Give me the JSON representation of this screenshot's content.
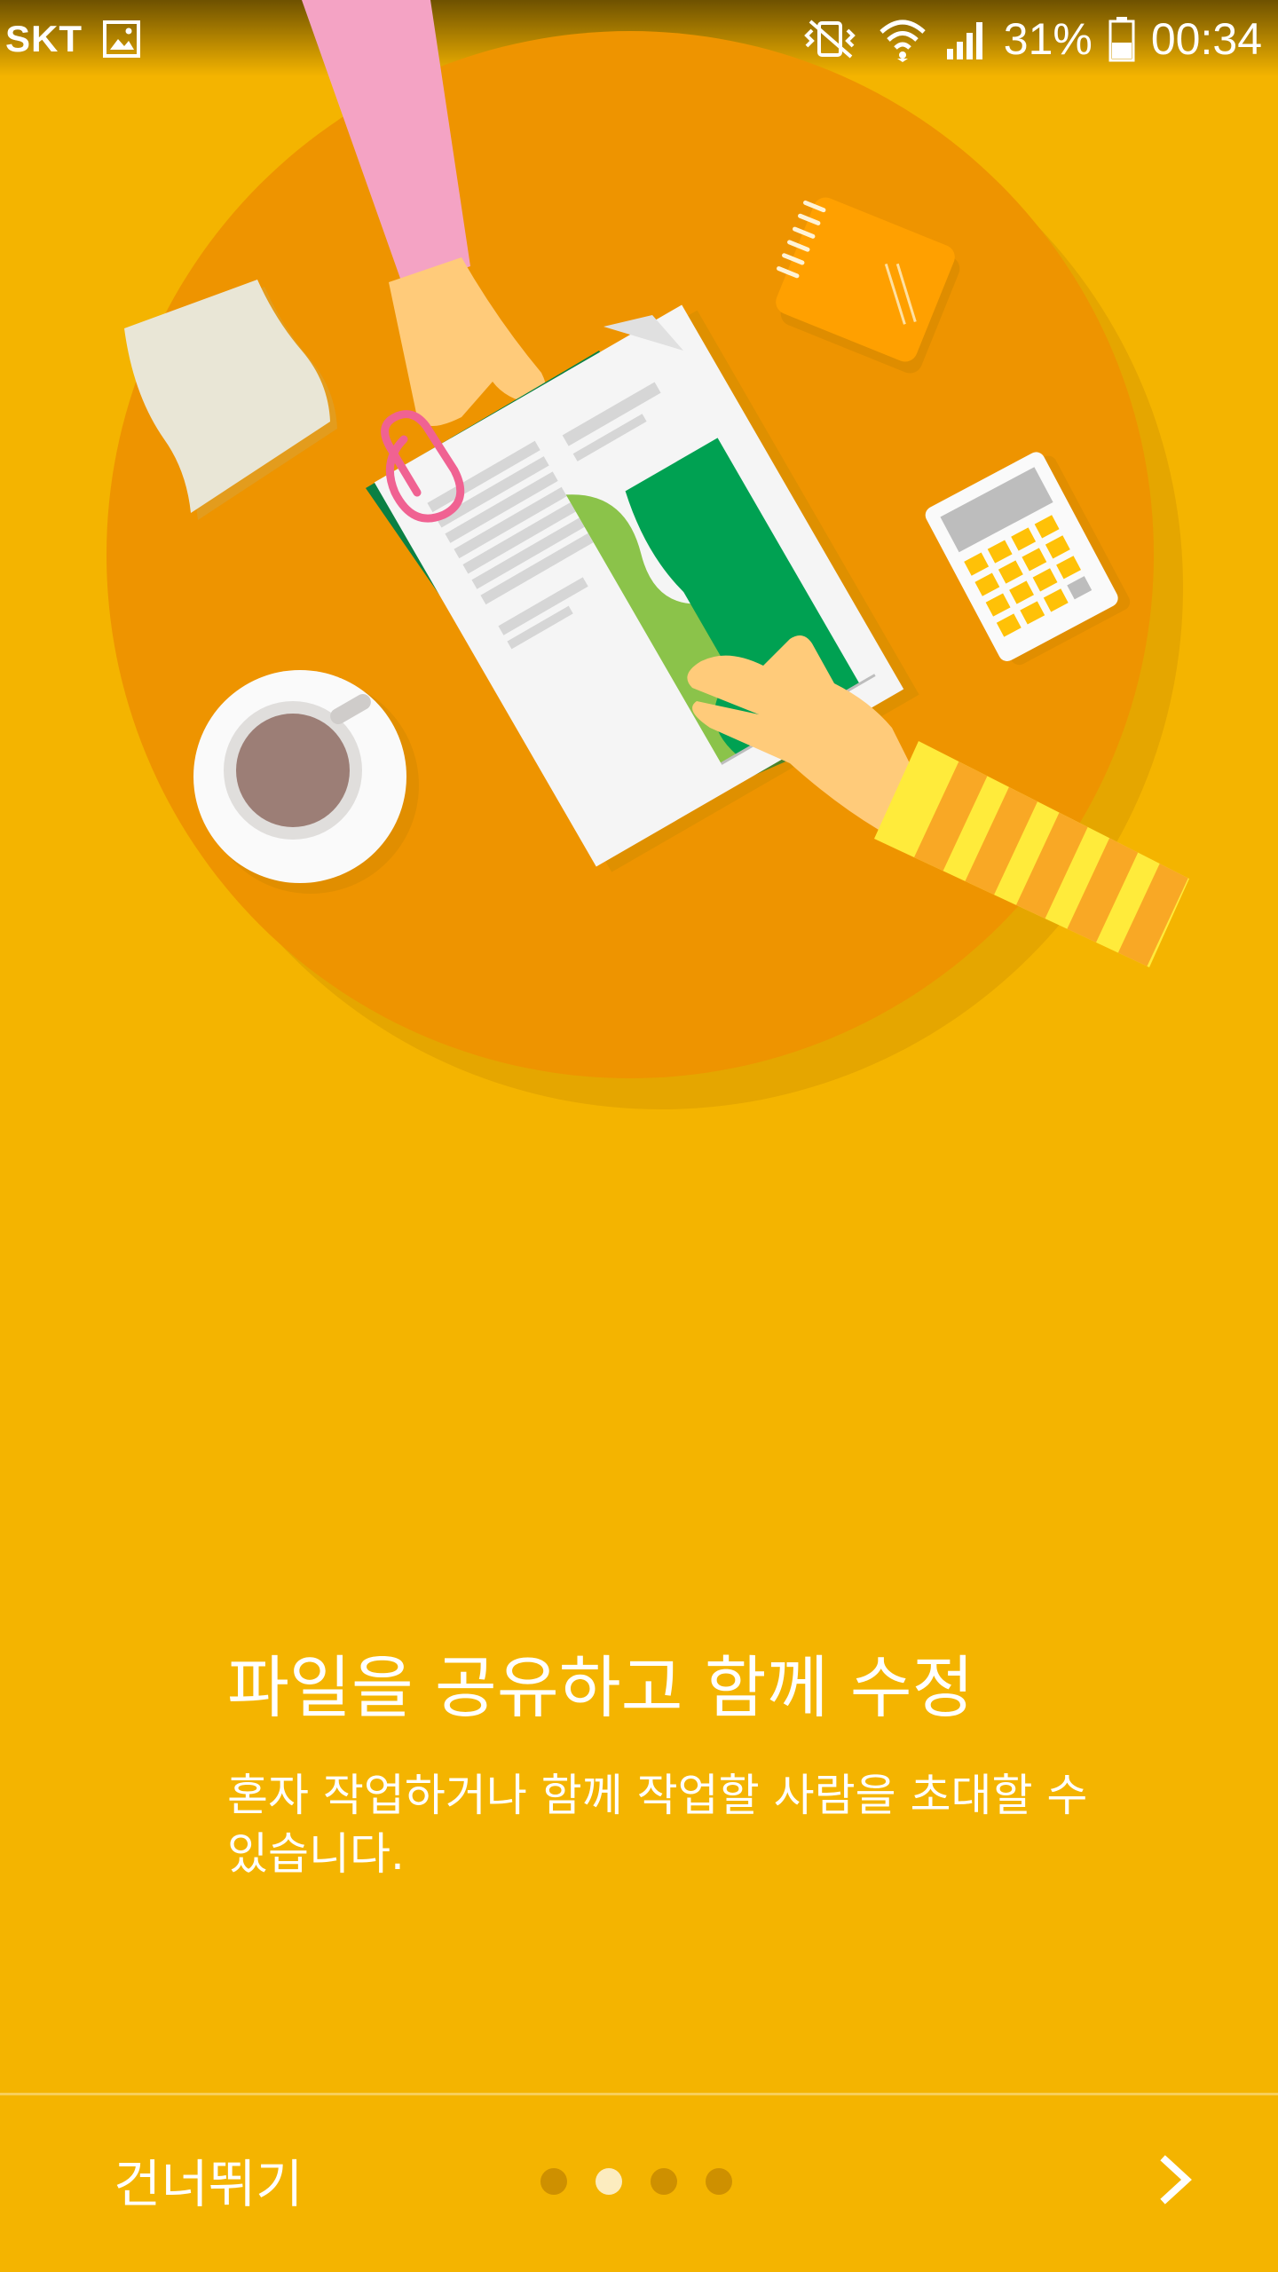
{
  "status_bar": {
    "carrier": "SKT",
    "battery_percent": "31%",
    "time": "00:34",
    "icons": [
      "gallery-notification-icon",
      "vibrate-mute-icon",
      "wifi-icon",
      "signal-icon",
      "battery-icon"
    ]
  },
  "onboarding": {
    "title": "파일을 공유하고 함께 수정",
    "description": "혼자 작업하거나 함께 작업할 사람을 초대할 수 있습니다."
  },
  "navigation": {
    "skip_label": "건너뛰기",
    "page_count": 4,
    "current_page": 2,
    "next_icon": "chevron-right-icon"
  },
  "colors": {
    "background": "#F4B400",
    "table": "#EE9400",
    "chart_green": "#0F9D58",
    "chart_light_green": "#8BC34A"
  }
}
